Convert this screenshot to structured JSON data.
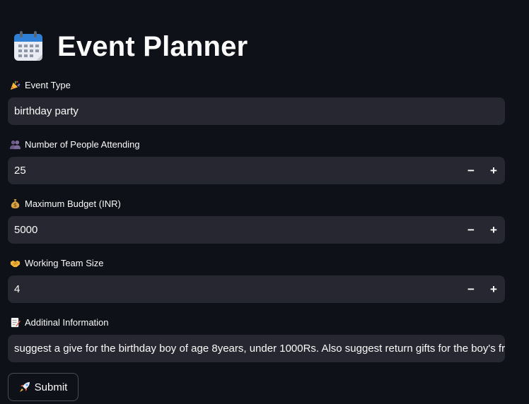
{
  "title": "Event Planner",
  "icons": {
    "title": "calendar-icon",
    "event_type": "party-popper-icon",
    "people": "people-icon",
    "budget": "money-bag-icon",
    "team": "handshake-icon",
    "info": "memo-icon",
    "submit": "rocket-icon"
  },
  "fields": {
    "event_type": {
      "label": "Event Type",
      "value": "birthday party"
    },
    "people": {
      "label": "Number of People Attending",
      "value": "25",
      "minus": "−",
      "plus": "+"
    },
    "budget": {
      "label": "Maximum Budget (INR)",
      "value": "5000",
      "minus": "−",
      "plus": "+"
    },
    "team": {
      "label": "Working Team Size",
      "value": "4",
      "minus": "−",
      "plus": "+"
    },
    "info": {
      "label": "Additinal Information",
      "value": "suggest a give for the birthday boy of age 8years, under 1000Rs. Also suggest return gifts for the boy's friends"
    }
  },
  "submit_label": "Submit",
  "colors": {
    "background": "#0e1117",
    "input": "#262730",
    "text": "#fafafa"
  }
}
